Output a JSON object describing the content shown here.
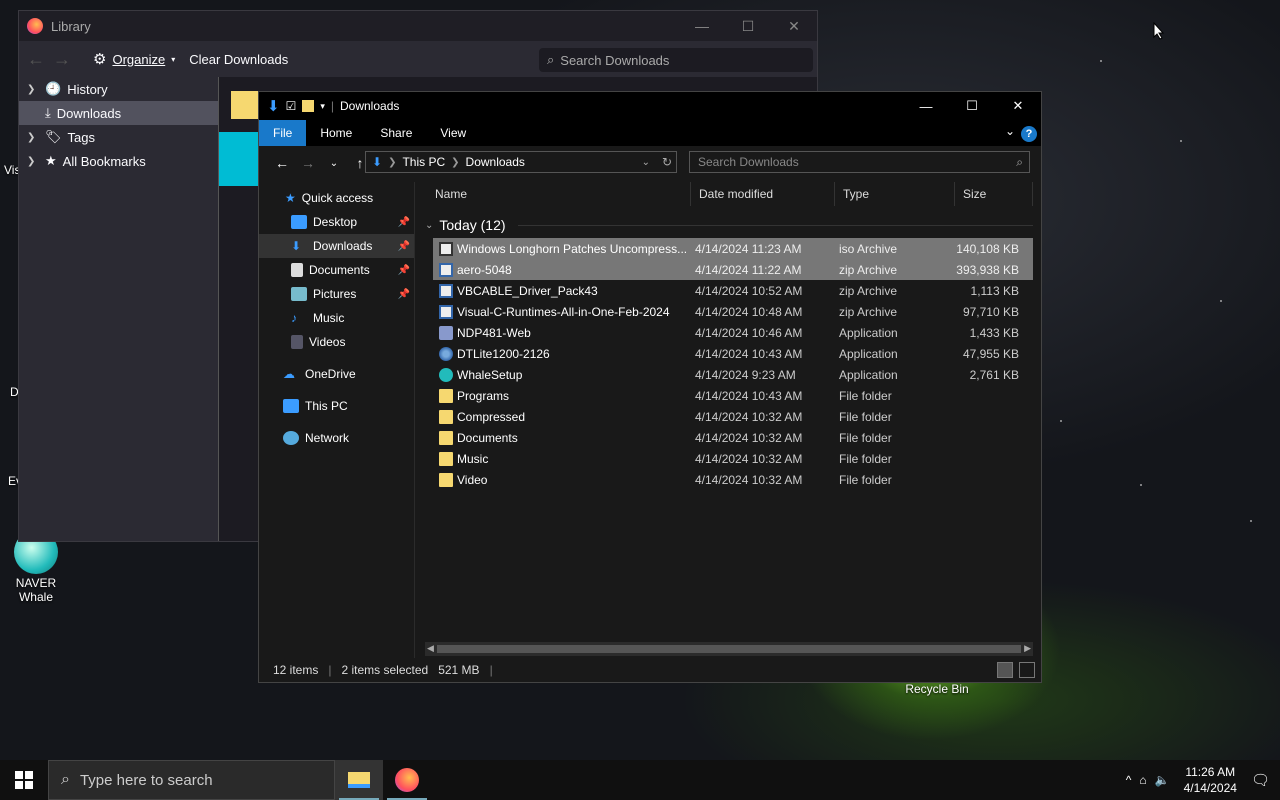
{
  "desktop": {
    "icons": [
      {
        "label": "NAVER\nWhale",
        "line1": "NAVER",
        "line2": "Whale"
      },
      {
        "label": "Recycle Bin"
      }
    ],
    "partial_labels": [
      "Vis",
      "D",
      "Ev"
    ]
  },
  "library": {
    "title": "Library",
    "toolbar": {
      "organize": "Organize",
      "clear": "Clear Downloads"
    },
    "search_placeholder": "Search Downloads",
    "sidebar": [
      {
        "label": "History",
        "expandable": true
      },
      {
        "label": "Downloads",
        "selected": true
      },
      {
        "label": "Tags",
        "expandable": true
      },
      {
        "label": "All Bookmarks",
        "expandable": true
      }
    ]
  },
  "explorer": {
    "title": "Downloads",
    "ribbon_tabs": [
      "File",
      "Home",
      "Share",
      "View"
    ],
    "address": {
      "root": "This PC",
      "current": "Downloads"
    },
    "search_placeholder": "Search Downloads",
    "nav": [
      {
        "label": "Quick access",
        "icon": "star-icon",
        "indent": 0
      },
      {
        "label": "Desktop",
        "icon": "desktop-icon",
        "indent": 1,
        "pinned": true
      },
      {
        "label": "Downloads",
        "icon": "download-icon",
        "indent": 1,
        "pinned": true,
        "selected": true
      },
      {
        "label": "Documents",
        "icon": "document-icon",
        "indent": 1,
        "pinned": true
      },
      {
        "label": "Pictures",
        "icon": "picture-icon",
        "indent": 1,
        "pinned": true
      },
      {
        "label": "Music",
        "icon": "music-icon",
        "indent": 1
      },
      {
        "label": "Videos",
        "icon": "video-icon",
        "indent": 1
      },
      {
        "label": "OneDrive",
        "icon": "cloud-icon",
        "indent": 0
      },
      {
        "label": "This PC",
        "icon": "pc-icon",
        "indent": 0
      },
      {
        "label": "Network",
        "icon": "network-icon",
        "indent": 0
      }
    ],
    "columns": {
      "name": "Name",
      "date": "Date modified",
      "type": "Type",
      "size": "Size"
    },
    "group": "Today (12)",
    "files": [
      {
        "name": "Windows Longhorn Patches Uncompress...",
        "date": "4/14/2024 11:23 AM",
        "type": "iso Archive",
        "size": "140,108 KB",
        "icon": "iso",
        "selected": true
      },
      {
        "name": "aero-5048",
        "date": "4/14/2024 11:22 AM",
        "type": "zip Archive",
        "size": "393,938 KB",
        "icon": "zip",
        "selected": true
      },
      {
        "name": "VBCABLE_Driver_Pack43",
        "date": "4/14/2024 10:52 AM",
        "type": "zip Archive",
        "size": "1,113 KB",
        "icon": "zip"
      },
      {
        "name": "Visual-C-Runtimes-All-in-One-Feb-2024",
        "date": "4/14/2024 10:48 AM",
        "type": "zip Archive",
        "size": "97,710 KB",
        "icon": "zip"
      },
      {
        "name": "NDP481-Web",
        "date": "4/14/2024 10:46 AM",
        "type": "Application",
        "size": "1,433 KB",
        "icon": "app"
      },
      {
        "name": "DTLite1200-2126",
        "date": "4/14/2024 10:43 AM",
        "type": "Application",
        "size": "47,955 KB",
        "icon": "disc"
      },
      {
        "name": "WhaleSetup",
        "date": "4/14/2024 9:23 AM",
        "type": "Application",
        "size": "2,761 KB",
        "icon": "whale"
      },
      {
        "name": "Programs",
        "date": "4/14/2024 10:43 AM",
        "type": "File folder",
        "size": "",
        "icon": "folder"
      },
      {
        "name": "Compressed",
        "date": "4/14/2024 10:32 AM",
        "type": "File folder",
        "size": "",
        "icon": "folder"
      },
      {
        "name": "Documents",
        "date": "4/14/2024 10:32 AM",
        "type": "File folder",
        "size": "",
        "icon": "folder"
      },
      {
        "name": "Music",
        "date": "4/14/2024 10:32 AM",
        "type": "File folder",
        "size": "",
        "icon": "folder"
      },
      {
        "name": "Video",
        "date": "4/14/2024 10:32 AM",
        "type": "File folder",
        "size": "",
        "icon": "folder"
      }
    ],
    "status": {
      "items": "12 items",
      "selected": "2 items selected",
      "size": "521 MB"
    }
  },
  "taskbar": {
    "search_placeholder": "Type here to search",
    "time": "11:26 AM",
    "date": "4/14/2024"
  },
  "colors": {
    "accent": "#1979ca",
    "selection": "#777777",
    "folder": "#f6d870"
  }
}
